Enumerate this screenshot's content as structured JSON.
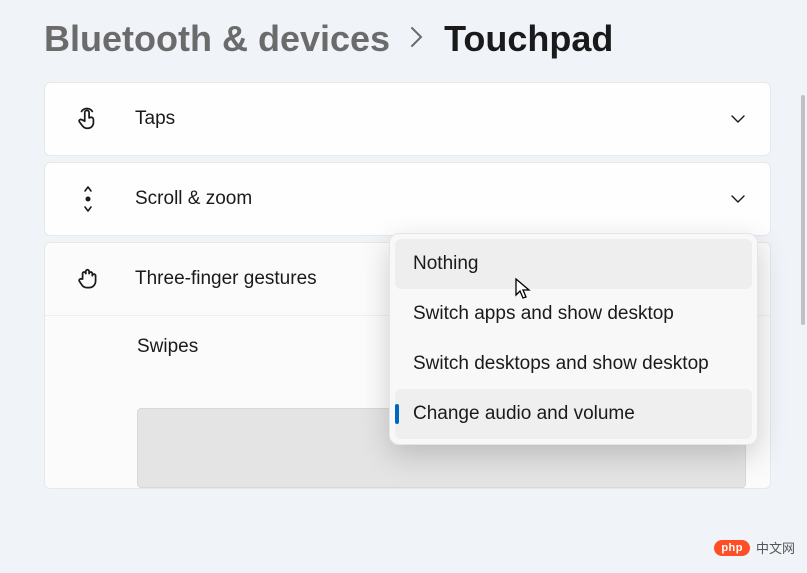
{
  "breadcrumb": {
    "parent": "Bluetooth & devices",
    "current": "Touchpad"
  },
  "sections": {
    "taps": {
      "title": "Taps"
    },
    "scroll_zoom": {
      "title": "Scroll & zoom"
    },
    "three_finger": {
      "title": "Three-finger gestures"
    },
    "swipes": {
      "label": "Swipes"
    }
  },
  "dropdown": {
    "items": [
      {
        "label": "Nothing"
      },
      {
        "label": "Switch apps and show desktop"
      },
      {
        "label": "Switch desktops and show desktop"
      },
      {
        "label": "Change audio and volume"
      }
    ]
  },
  "watermark": {
    "badge": "php",
    "text": "中文网"
  }
}
